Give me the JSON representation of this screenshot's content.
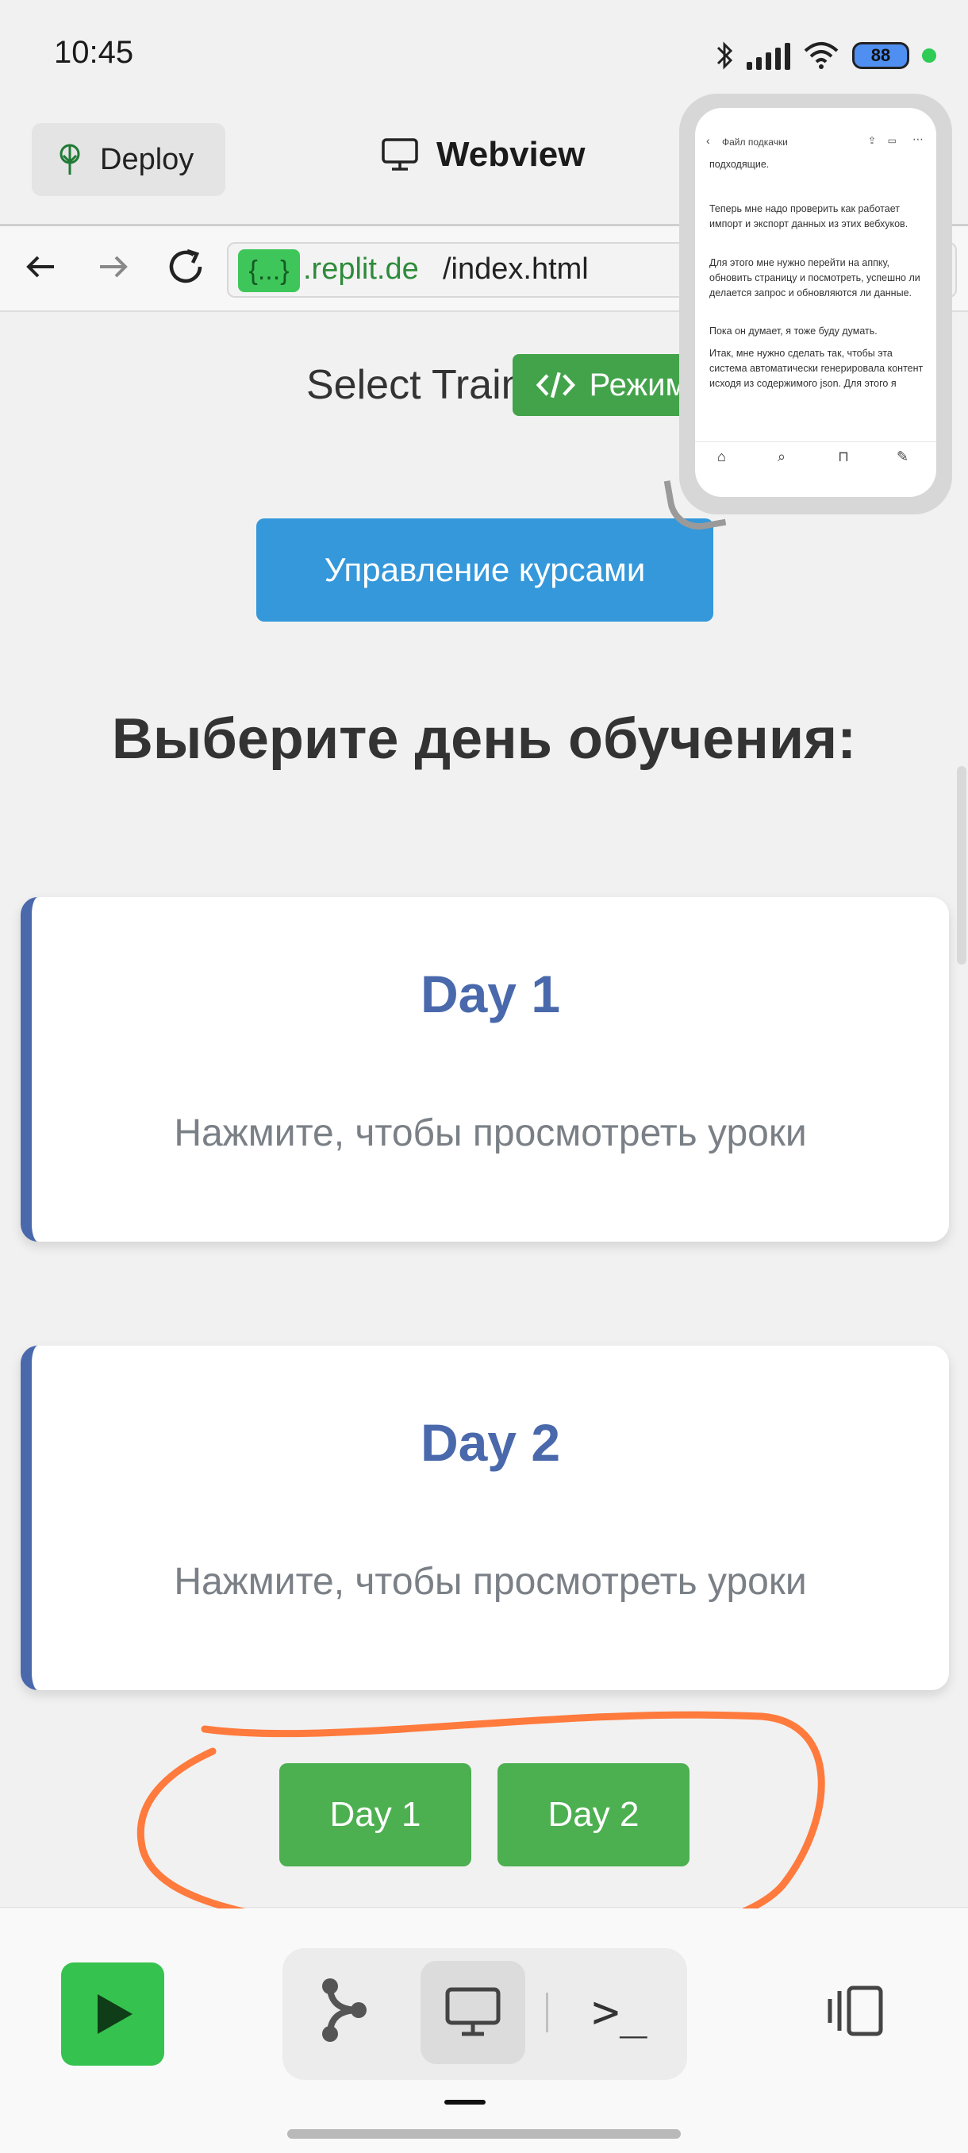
{
  "status_bar": {
    "time": "10:45",
    "battery": "88"
  },
  "header": {
    "deploy_label": "Deploy",
    "title": "Webview"
  },
  "urlbar": {
    "badge": "{...}",
    "domain": ".replit.de",
    "path": "/index.html"
  },
  "page": {
    "select_training": "Select Train",
    "mode_badge": "Режим",
    "manage_button": "Управление курсами",
    "heading": "Выберите день обучения:",
    "cards": [
      {
        "title": "Day 1",
        "subtitle": "Нажмите, чтобы просмотреть уроки"
      },
      {
        "title": "Day 2",
        "subtitle": "Нажмите, чтобы просмотреть уроки"
      }
    ],
    "day_buttons": [
      "Day 1",
      "Day 2"
    ]
  },
  "mini_window": {
    "title": "Файл подкачки",
    "lines": [
      "подходящие.",
      "Теперь мне надо проверить как работает импорт и экспорт данных из этих вебхуков.",
      "Для этого мне нужно перейти на аппку, обновить страницу и посмотреть, успешно ли делается запрос и обновляются ли данные.",
      "Пока он думает, я тоже буду думать.",
      "Итак, мне нужно сделать так, чтобы эта система автоматически генерировала контент исходя из содержимого json. Для этого я"
    ]
  },
  "colors": {
    "accent_green": "#4caf50",
    "manage_blue": "#3498db",
    "card_blue": "#4a69ac",
    "annotation": "#ff7a3d",
    "run_green": "#36c24e"
  }
}
